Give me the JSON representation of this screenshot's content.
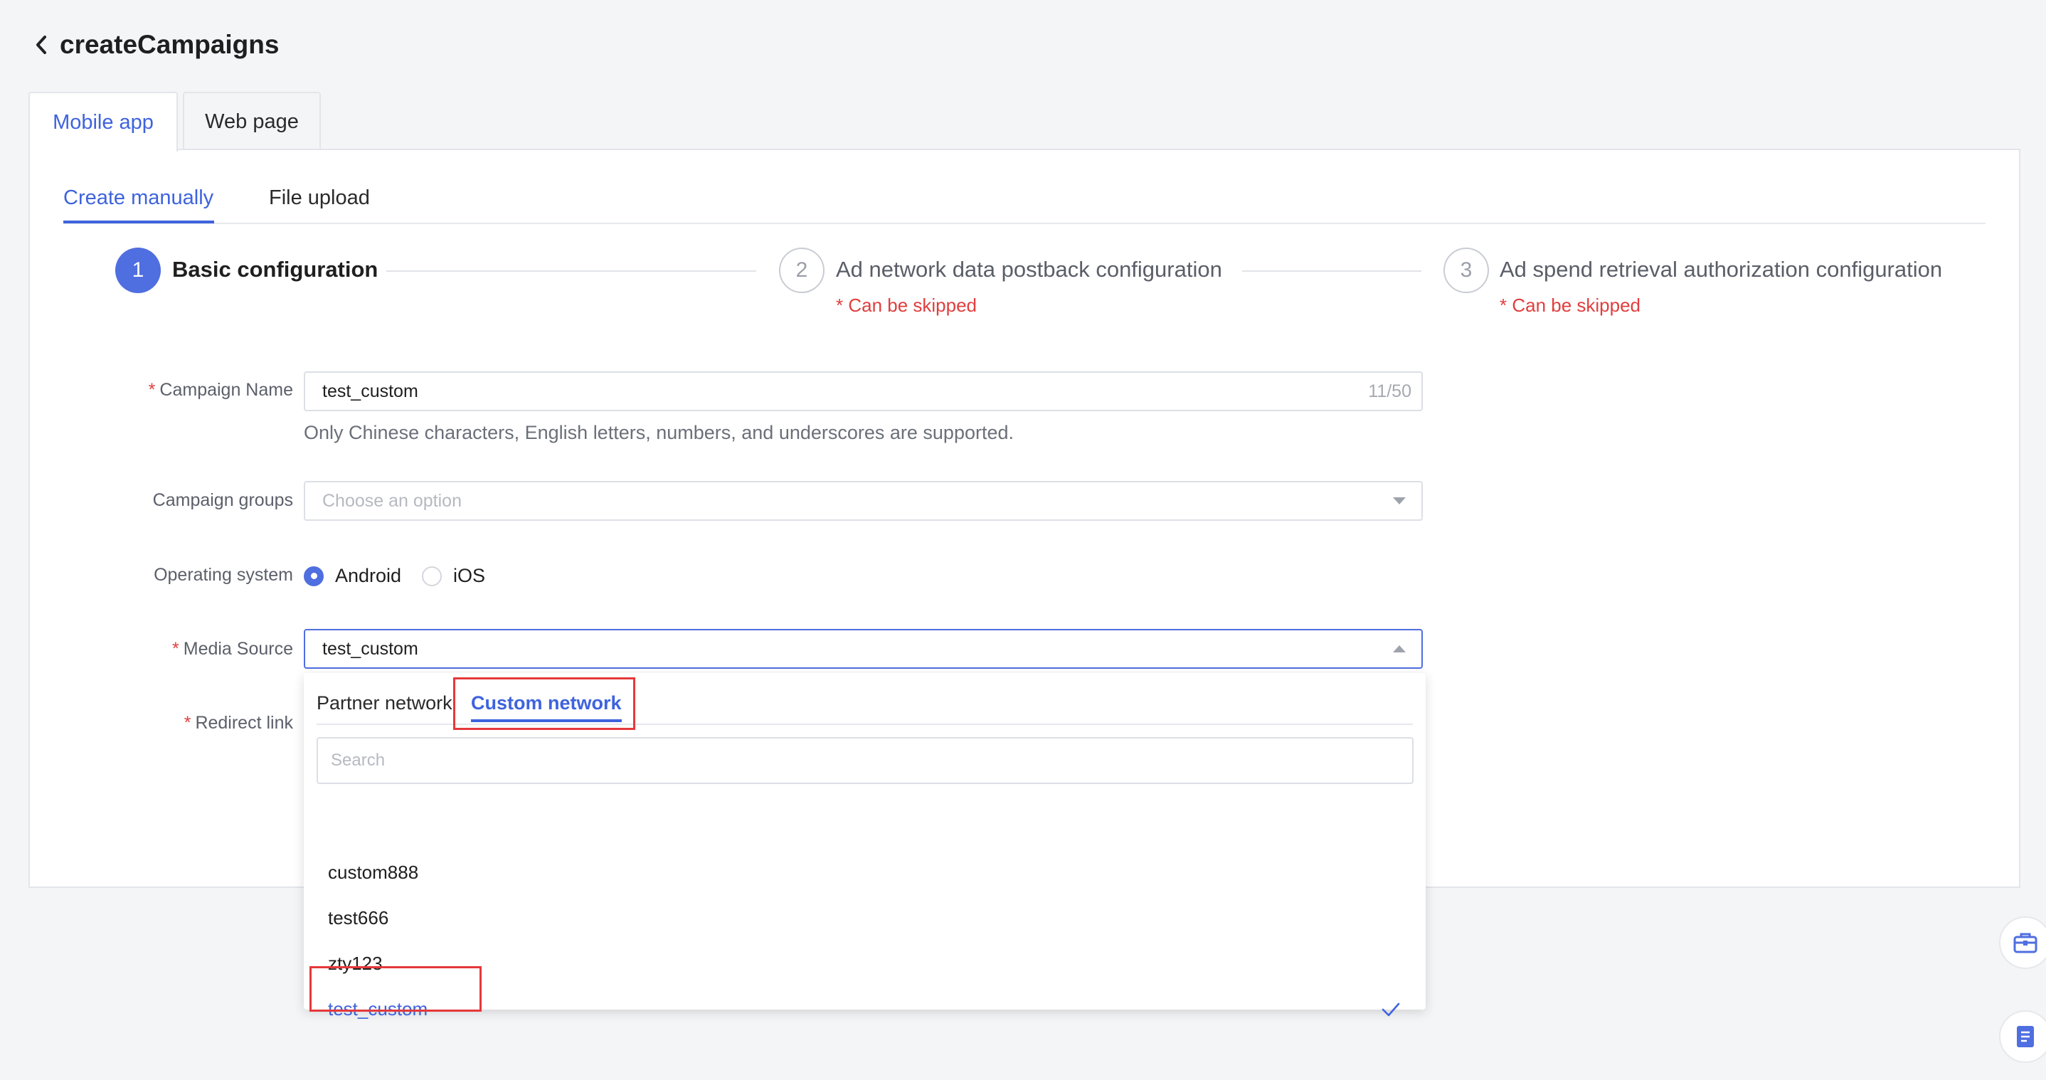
{
  "header": {
    "title": "createCampaigns"
  },
  "top_tabs": [
    {
      "label": "Mobile app",
      "active": true
    },
    {
      "label": "Web page",
      "active": false
    }
  ],
  "sub_tabs": [
    {
      "label": "Create manually",
      "active": true
    },
    {
      "label": "File upload",
      "active": false
    }
  ],
  "steps": [
    {
      "number": "1",
      "title": "Basic configuration",
      "note": ""
    },
    {
      "number": "2",
      "title": "Ad network data postback configuration",
      "note": "* Can be skipped"
    },
    {
      "number": "3",
      "title": "Ad spend retrieval authorization configuration",
      "note": "* Can be skipped"
    }
  ],
  "form": {
    "campaign_name": {
      "label": "Campaign Name",
      "value": "test_custom",
      "counter": "11/50",
      "hint": "Only Chinese characters, English letters, numbers, and underscores are supported."
    },
    "campaign_groups": {
      "label": "Campaign groups",
      "placeholder": "Choose an option"
    },
    "operating_system": {
      "label": "Operating system",
      "options": [
        "Android",
        "iOS"
      ],
      "selected": "Android"
    },
    "media_source": {
      "label": "Media Source",
      "value": "test_custom"
    },
    "redirect_link": {
      "label": "Redirect link"
    },
    "required_mark": "*"
  },
  "dropdown": {
    "tabs": [
      {
        "label": "Partner network"
      },
      {
        "label": "Custom network"
      }
    ],
    "active_tab": "Custom network",
    "search_placeholder": "Search",
    "items": [
      "custom888",
      "test666",
      "zty123",
      "test_custom"
    ],
    "selected_item": "test_custom"
  },
  "colors": {
    "accent": "#3e63dd",
    "required": "#e03e3e",
    "highlight_box": "#e5393b"
  }
}
